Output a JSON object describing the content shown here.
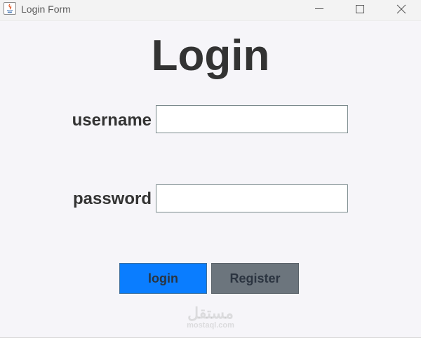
{
  "window": {
    "title": "Login Form",
    "controls": {
      "minimize": "minimize-icon",
      "maximize": "maximize-icon",
      "close": "close-icon"
    }
  },
  "form": {
    "heading": "Login",
    "username_label": "username",
    "username_value": "",
    "password_label": "password",
    "password_value": ""
  },
  "buttons": {
    "login_label": "login",
    "register_label": "Register"
  },
  "watermark": {
    "arabic": "مستقل",
    "latin": "mostaql.com"
  },
  "colors": {
    "login_button": "#0a7dff",
    "register_button": "#6c757d",
    "background": "#f6f5f9",
    "text": "#333333"
  }
}
